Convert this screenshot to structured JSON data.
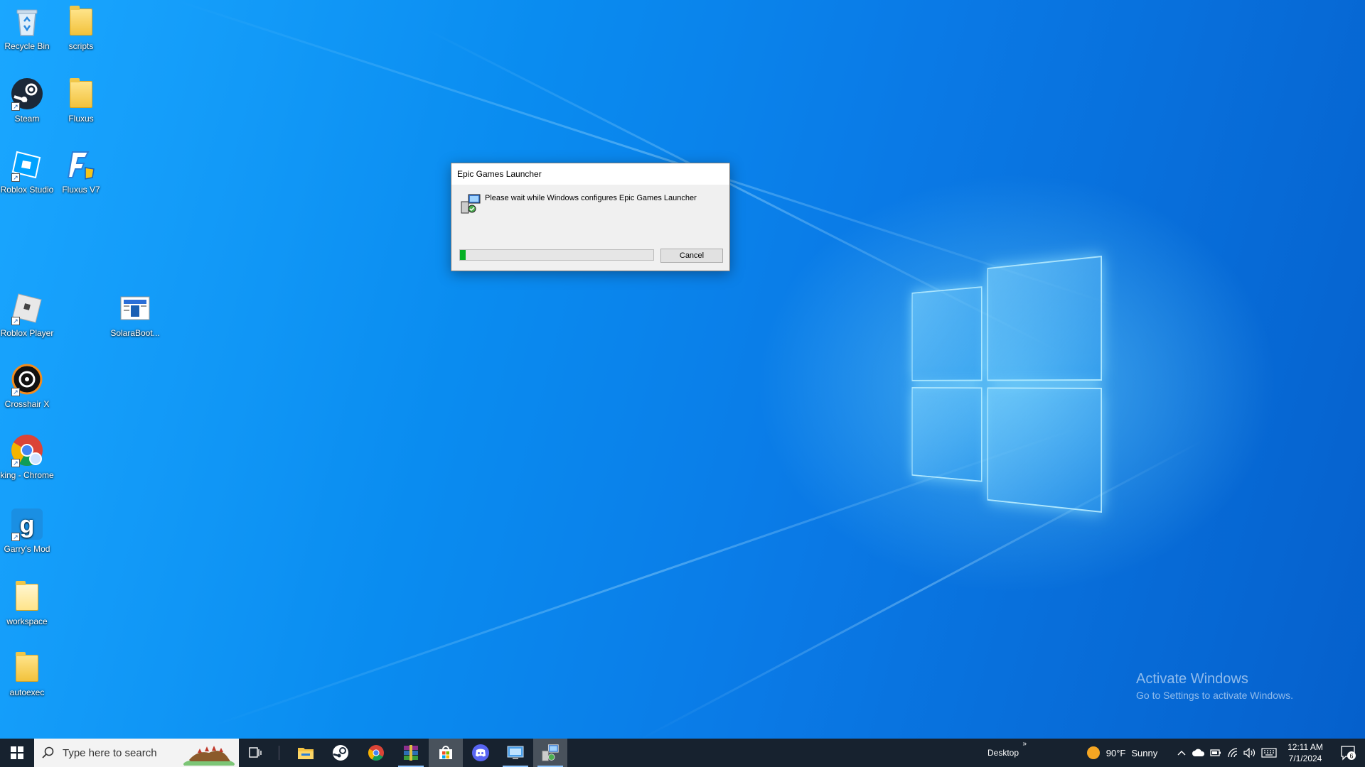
{
  "desktop": {
    "icons": [
      {
        "label": "Recycle Bin",
        "icon": "recycle-bin-icon"
      },
      {
        "label": "scripts",
        "icon": "folder-icon"
      },
      {
        "label": "Steam",
        "icon": "steam-icon"
      },
      {
        "label": "Fluxus",
        "icon": "folder-icon"
      },
      {
        "label": "Roblox Studio",
        "icon": "roblox-studio-icon"
      },
      {
        "label": "Fluxus V7",
        "icon": "fluxus-icon"
      },
      {
        "label": "Roblox Player",
        "icon": "roblox-player-icon"
      },
      {
        "label": "SolaraBoot...",
        "icon": "solara-icon"
      },
      {
        "label": "Crosshair X",
        "icon": "crosshair-icon"
      },
      {
        "label": "king - Chrome",
        "icon": "chrome-icon"
      },
      {
        "label": "Garry's Mod",
        "icon": "gmod-icon"
      },
      {
        "label": "workspace",
        "icon": "folder-icon"
      },
      {
        "label": "autoexec",
        "icon": "folder-icon"
      }
    ]
  },
  "dialog": {
    "title": "Epic Games Launcher",
    "message": "Please wait while Windows configures Epic Games Launcher",
    "progress": 0.03,
    "cancel_label": "Cancel"
  },
  "watermark": {
    "line1": "Activate Windows",
    "line2": "Go to Settings to activate Windows."
  },
  "taskbar": {
    "search_placeholder": "Type here to search",
    "pinned": [
      {
        "name": "task-view-icon"
      },
      {
        "name": "file-explorer-icon"
      },
      {
        "name": "steam-icon"
      },
      {
        "name": "chrome-icon"
      },
      {
        "name": "winrar-icon"
      },
      {
        "name": "microsoft-store-icon"
      },
      {
        "name": "discord-icon"
      },
      {
        "name": "remote-desktop-icon"
      },
      {
        "name": "installer-icon"
      }
    ],
    "desktop_label": "Desktop",
    "weather": {
      "temp": "90°F",
      "condition": "Sunny"
    },
    "clock": {
      "time": "12:11 AM",
      "date": "7/1/2024"
    },
    "notification_count": "6",
    "colors": {
      "background": "#17222f",
      "progress": "#06b025"
    }
  }
}
